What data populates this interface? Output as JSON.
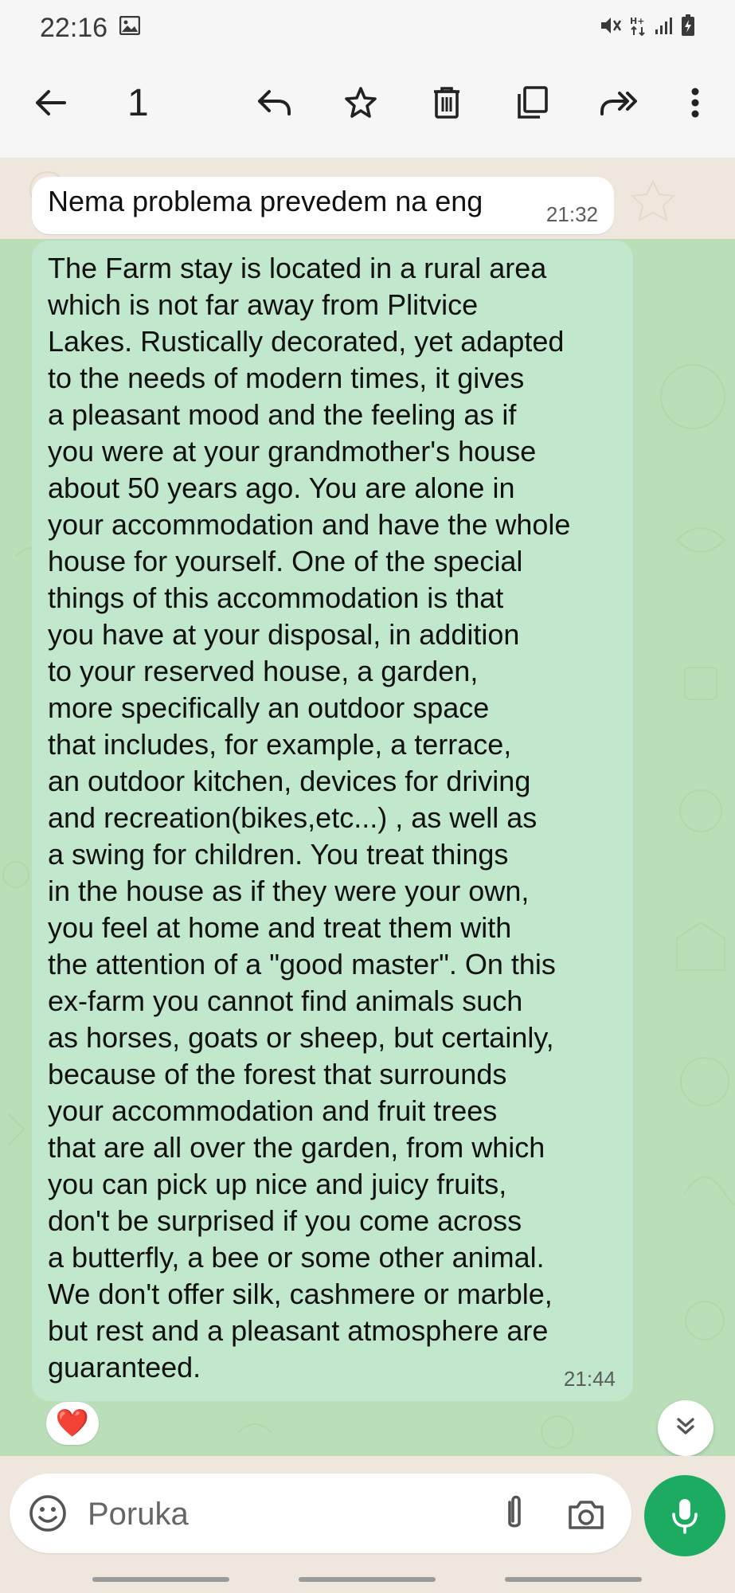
{
  "status_bar": {
    "time": "22:16"
  },
  "toolbar": {
    "selected_count": "1"
  },
  "messages": {
    "incoming": {
      "text": "Nema problema prevedem na eng",
      "time": "21:32"
    },
    "outgoing": {
      "lines": [
        "The Farm stay is located in a rural area",
        "which is not far away from Plitvice",
        "Lakes. Rustically decorated, yet adapted",
        "to the needs of modern times, it gives",
        "a pleasant mood and the feeling as if",
        "you were at your grandmother's house",
        "about 50 years ago. You are alone in",
        "your accommodation and have the whole",
        "house for yourself. One of the special",
        "things of this accommodation is that",
        "you have at your disposal, in addition",
        "to your reserved house, a garden,",
        "more specifically an outdoor space",
        "that includes, for example, a terrace,",
        "an outdoor kitchen, devices for driving",
        "and recreation(bikes,etc...) , as well as",
        "a swing for children. You treat things",
        "in the house as if they were your own,",
        "you feel at home and treat them with",
        "the attention of a \"good master\". On this",
        "ex-farm you cannot find animals such",
        "as horses, goats or sheep, but certainly,",
        "because of the forest that surrounds",
        "your accommodation and fruit trees",
        "that are all over the garden, from which",
        "you can pick up nice and juicy fruits,",
        "don't be surprised if you come across",
        "a butterfly, a bee or some other animal.",
        "We don't offer silk, cashmere or marble,",
        "but rest and a pleasant atmosphere are",
        "guaranteed."
      ],
      "time": "21:44",
      "reaction": "❤️"
    }
  },
  "composer": {
    "placeholder": "Poruka"
  },
  "colors": {
    "accent_green": "#1daa61",
    "outgoing_bubble": "#c1e8cc",
    "selection_overlay": "#78d28c"
  },
  "icons": {
    "toolbar": [
      "back-arrow-icon",
      "reply-icon",
      "star-icon",
      "delete-icon",
      "copy-icon",
      "forward-icon",
      "more-vert-icon"
    ],
    "composer": [
      "emoji-icon",
      "attach-icon",
      "camera-icon",
      "mic-icon"
    ]
  }
}
